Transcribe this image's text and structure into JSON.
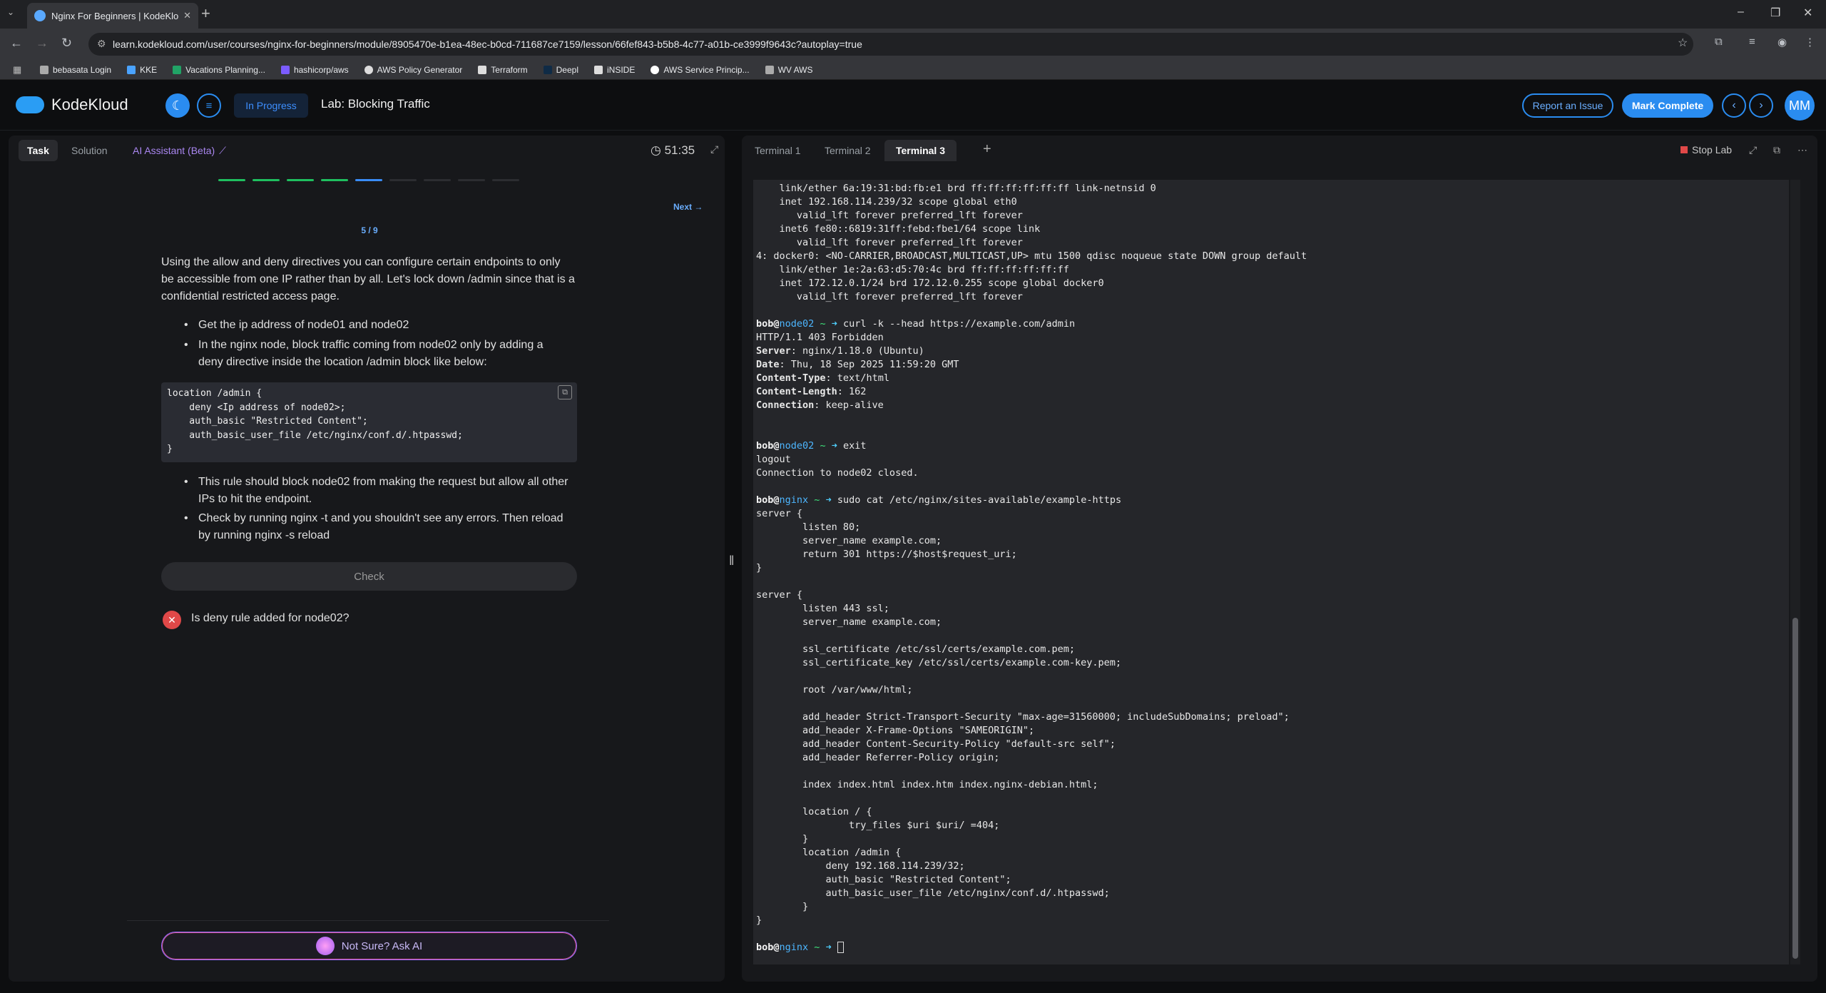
{
  "browser": {
    "tab_title": "Nginx For Beginners | KodeKlou",
    "url": "learn.kodekloud.com/user/courses/nginx-for-beginners/module/8905470e-b1ea-48ec-b0cd-711687ce7159/lesson/66fef843-b5b8-4c77-a01b-ce3999f9643c?autoplay=true",
    "bookmarks": [
      "bebasata Login",
      "KKE",
      "Vacations Planning...",
      "hashicorp/aws",
      "AWS Policy Generator",
      "Terraform",
      "Deepl",
      "iNSIDE",
      "AWS Service Princip...",
      "WV AWS"
    ]
  },
  "header": {
    "logo": "KodeKloud",
    "status": "In Progress",
    "lab_title": "Lab: Blocking Traffic",
    "report": "Report an Issue",
    "mark_complete": "Mark Complete",
    "avatar": "MM"
  },
  "left": {
    "tabs": {
      "task": "Task",
      "solution": "Solution",
      "ai": "AI Assistant (Beta)"
    },
    "timer": "51:35",
    "progress": {
      "done": 4,
      "current": 5,
      "total": 9,
      "label": "5 / 9",
      "done_color": "#1fbf5f",
      "current_color": "#3a8cf6"
    },
    "next": "Next",
    "intro": "Using the allow and deny directives you can configure certain endpoints to only be accessible from one IP rather than by all. Let's lock down /admin since that is a confidential restricted access page.",
    "bullets1": [
      "Get the ip address of node01 and node02",
      "In the nginx node, block traffic coming from node02 only by adding a deny directive inside the location /admin block like below:"
    ],
    "code": "location /admin {\n    deny <Ip address of node02>;\n    auth_basic \"Restricted Content\";\n    auth_basic_user_file /etc/nginx/conf.d/.htpasswd;\n}",
    "bullets2": [
      "This rule should block node02 from making the request but allow all other IPs to hit the endpoint.",
      "Check by running nginx -t and you shouldn't see any errors. Then reload by running nginx -s reload"
    ],
    "check": "Check",
    "result": "Is deny rule added for node02?",
    "ask_ai": "Not Sure? Ask AI"
  },
  "right": {
    "tabs": [
      "Terminal 1",
      "Terminal 2",
      "Terminal 3"
    ],
    "stop_lab": "Stop Lab"
  },
  "terminal": [
    {
      "t": "    link/ether 6a:19:31:bd:fb:e1 brd ff:ff:ff:ff:ff:ff link-netnsid 0"
    },
    {
      "t": "    inet 192.168.114.239/32 scope global eth0"
    },
    {
      "t": "       valid_lft forever preferred_lft forever"
    },
    {
      "t": "    inet6 fe80::6819:31ff:febd:fbe1/64 scope link"
    },
    {
      "t": "       valid_lft forever preferred_lft forever"
    },
    {
      "t": "4: docker0: <NO-CARRIER,BROADCAST,MULTICAST,UP> mtu 1500 qdisc noqueue state DOWN group default"
    },
    {
      "t": "    link/ether 1e:2a:63:d5:70:4c brd ff:ff:ff:ff:ff:ff"
    },
    {
      "t": "    inet 172.12.0.1/24 brd 172.12.0.255 scope global docker0"
    },
    {
      "t": "       valid_lft forever preferred_lft forever"
    },
    {
      "t": ""
    },
    {
      "u": "bob",
      "h": "node02",
      "c": "curl -k --head https://example.com/admin"
    },
    {
      "t": "HTTP/1.1 403 Forbidden"
    },
    {
      "k": "Server",
      "t": ": nginx/1.18.0 (Ubuntu)"
    },
    {
      "k": "Date",
      "t": ": Thu, 18 Sep 2025 11:59:20 GMT"
    },
    {
      "k": "Content-Type",
      "t": ": text/html"
    },
    {
      "k": "Content-Length",
      "t": ": 162"
    },
    {
      "k": "Connection",
      "t": ": keep-alive"
    },
    {
      "t": ""
    },
    {
      "t": ""
    },
    {
      "u": "bob",
      "h": "node02",
      "c": "exit"
    },
    {
      "t": "logout"
    },
    {
      "t": "Connection to node02 closed."
    },
    {
      "t": ""
    },
    {
      "u": "bob",
      "h": "nginx",
      "c": "sudo cat /etc/nginx/sites-available/example-https"
    },
    {
      "t": "server {"
    },
    {
      "t": "        listen 80;"
    },
    {
      "t": "        server_name example.com;"
    },
    {
      "t": "        return 301 https://$host$request_uri;"
    },
    {
      "t": "}"
    },
    {
      "t": ""
    },
    {
      "t": "server {"
    },
    {
      "t": "        listen 443 ssl;"
    },
    {
      "t": "        server_name example.com;"
    },
    {
      "t": ""
    },
    {
      "t": "        ssl_certificate /etc/ssl/certs/example.com.pem;"
    },
    {
      "t": "        ssl_certificate_key /etc/ssl/certs/example.com-key.pem;"
    },
    {
      "t": ""
    },
    {
      "t": "        root /var/www/html;"
    },
    {
      "t": ""
    },
    {
      "t": "        add_header Strict-Transport-Security \"max-age=31560000; includeSubDomains; preload\";"
    },
    {
      "t": "        add_header X-Frame-Options \"SAMEORIGIN\";"
    },
    {
      "t": "        add_header Content-Security-Policy \"default-src self\";"
    },
    {
      "t": "        add_header Referrer-Policy origin;"
    },
    {
      "t": ""
    },
    {
      "t": "        index index.html index.htm index.nginx-debian.html;"
    },
    {
      "t": ""
    },
    {
      "t": "        location / {"
    },
    {
      "t": "                try_files $uri $uri/ =404;"
    },
    {
      "t": "        }"
    },
    {
      "t": "        location /admin {"
    },
    {
      "t": "            deny 192.168.114.239/32;"
    },
    {
      "t": "            auth_basic \"Restricted Content\";"
    },
    {
      "t": "            auth_basic_user_file /etc/nginx/conf.d/.htpasswd;"
    },
    {
      "t": "        }"
    },
    {
      "t": "}"
    },
    {
      "t": ""
    },
    {
      "u": "bob",
      "h": "nginx",
      "c": "",
      "cursor": true
    }
  ]
}
